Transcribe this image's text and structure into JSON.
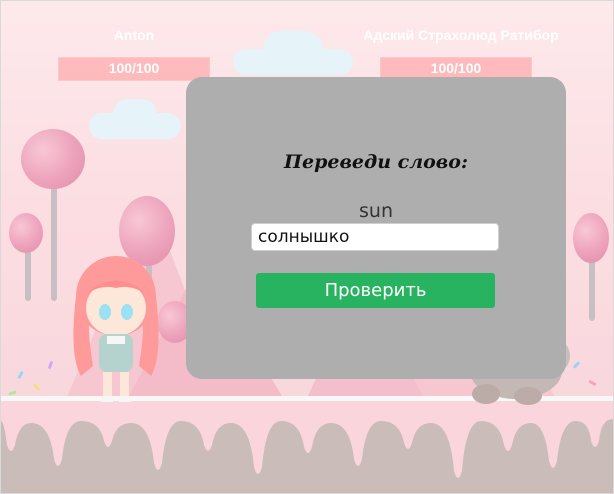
{
  "players": {
    "left": {
      "name": "Anton",
      "hp": "100/100",
      "hp_fraction": 1.0
    },
    "right": {
      "name": "Адский Страхолюд Ратибор",
      "hp": "100/100",
      "hp_fraction": 1.0
    }
  },
  "dialog": {
    "title": "Переведи слово:",
    "word": "sun",
    "answer_value": "солнышко",
    "submit_label": "Проверить"
  },
  "colors": {
    "modal_bg": "#aeaeae",
    "button_bg": "#27b35f",
    "hp_bar": "#ff7b7b",
    "ground": "#bca9a6"
  },
  "icons": [
    "lollipop-tree",
    "cloud",
    "girl-character",
    "monster-character"
  ]
}
